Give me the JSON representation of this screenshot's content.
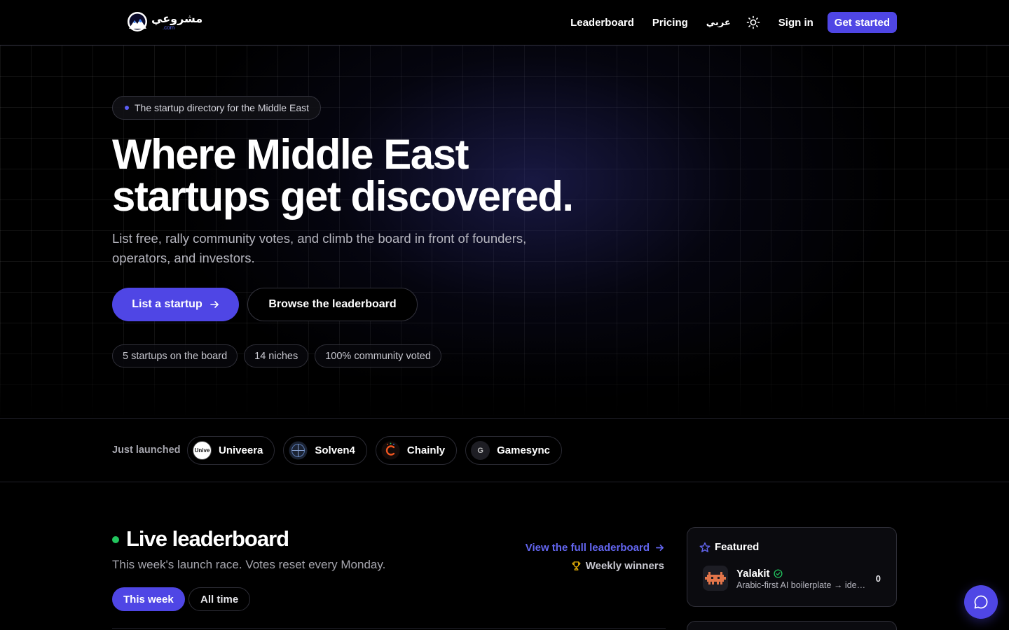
{
  "nav": {
    "logo_ar": "مشروعي",
    "logo_com": ".com",
    "links": [
      "Leaderboard",
      "Pricing"
    ],
    "lang": "عربي",
    "signin": "Sign in",
    "get_started": "Get started"
  },
  "hero": {
    "tag": "The startup directory for the Middle East",
    "title_line1": "Where Middle East",
    "title_line2": "startups get discovered.",
    "subtitle": "List free, rally community votes, and climb the board in front of founders, operators, and investors.",
    "cta_primary": "List a startup",
    "cta_secondary": "Browse the leaderboard",
    "stats": [
      "5 startups on the board",
      "14 niches",
      "100% community voted"
    ]
  },
  "launched": {
    "label": "Just launched",
    "items": [
      {
        "name": "Univeera",
        "avatar_text": "Unive"
      },
      {
        "name": "Solven4",
        "avatar_text": ""
      },
      {
        "name": "Chainly",
        "avatar_text": ""
      },
      {
        "name": "Gamesync",
        "avatar_text": "G"
      }
    ]
  },
  "leaderboard": {
    "title": "Live leaderboard",
    "subtitle": "This week's launch race. Votes reset every Monday.",
    "tab_week": "This week",
    "tab_all": "All time",
    "view_full": "View the full leaderboard",
    "weekly_winners": "Weekly winners"
  },
  "featured": {
    "heading": "Featured",
    "name": "Yalakit",
    "description": "Arabic-first AI boilerplate → idea to launch",
    "votes": "0"
  },
  "colors": {
    "accent": "#4f46e5",
    "link": "#6366f1",
    "live_dot": "#22c55e"
  }
}
